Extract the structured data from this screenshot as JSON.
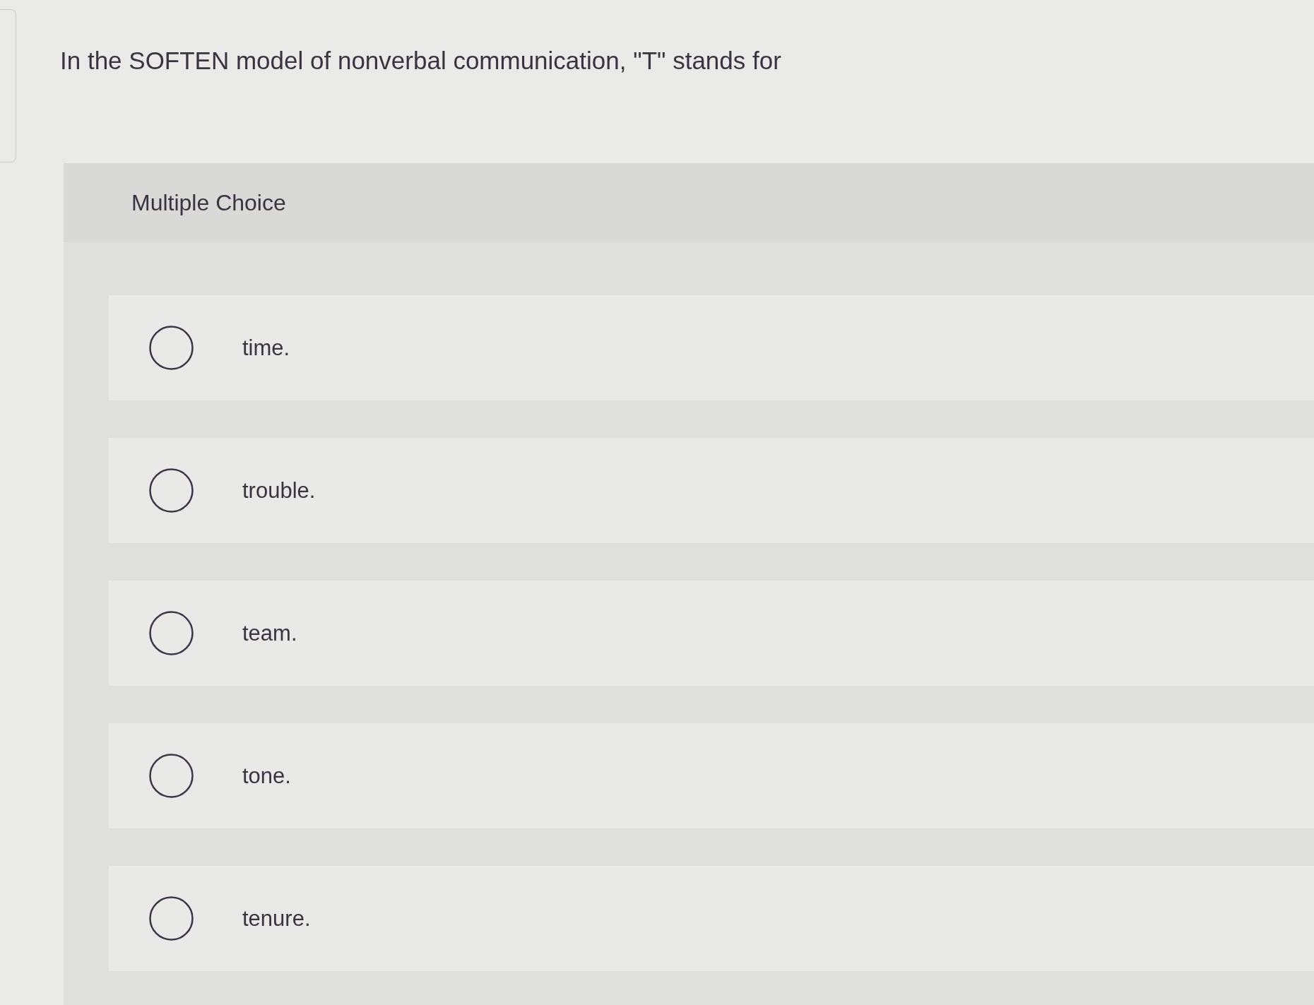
{
  "question": {
    "text": "In the SOFTEN model of nonverbal communication, \"T\" stands for"
  },
  "panel": {
    "label": "Multiple Choice",
    "options": [
      {
        "label": "time.",
        "selected": false
      },
      {
        "label": "trouble.",
        "selected": false
      },
      {
        "label": "team.",
        "selected": false
      },
      {
        "label": "tone.",
        "selected": false
      },
      {
        "label": "tenure.",
        "selected": false
      }
    ]
  }
}
